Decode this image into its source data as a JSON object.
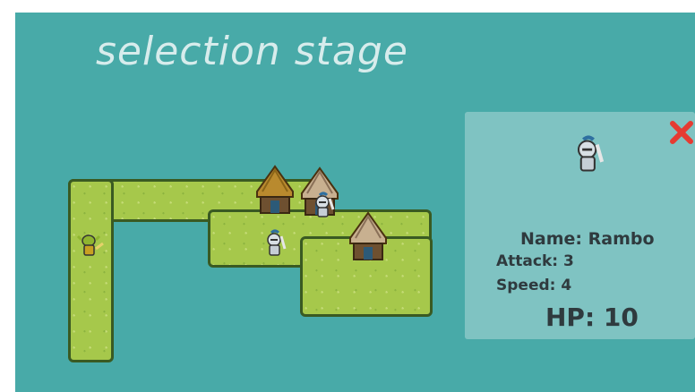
{
  "title": "selection stage",
  "selected_unit": {
    "name_line": "Name: Rambo",
    "attack_line": "Attack: 3",
    "speed_line": "Speed: 4",
    "hp_line": "HP: 10"
  },
  "icons": {
    "close": "close-icon",
    "unit": "knight-icon",
    "enemy": "goblin-icon",
    "hut": "hut-icon"
  },
  "colors": {
    "background": "#48aaa8",
    "grass": "#a6c84b",
    "close": "#e53b32"
  }
}
